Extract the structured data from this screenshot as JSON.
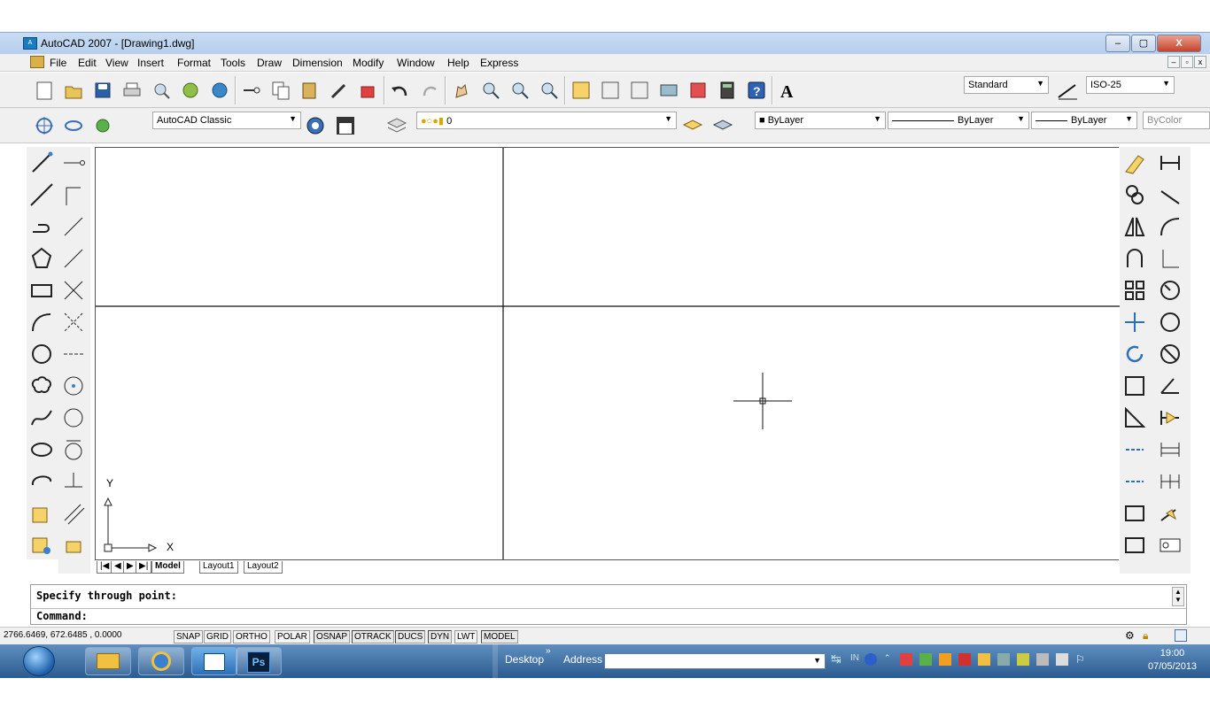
{
  "window": {
    "title": "AutoCAD 2007 - [Drawing1.dwg]",
    "controls": [
      "–",
      "▢",
      "X"
    ],
    "mdi_controls": [
      "–",
      "▫",
      "x"
    ]
  },
  "menu": [
    "File",
    "Edit",
    "View",
    "Insert",
    "Format",
    "Tools",
    "Draw",
    "Dimension",
    "Modify",
    "Window",
    "Help",
    "Express"
  ],
  "toolbar1": {
    "text_style": "Standard",
    "dim_style": "ISO-25"
  },
  "toolbar2": {
    "workspace": "AutoCAD Classic",
    "layer": "0",
    "color": "ByLayer",
    "linetype": "ByLayer",
    "lineweight": "ByLayer",
    "plotstyle": "ByColor"
  },
  "ucs": {
    "x_label": "X",
    "y_label": "Y"
  },
  "tabs": {
    "nav": [
      "|◀",
      "◀",
      "▶",
      "▶|"
    ],
    "items": [
      "Model",
      "Layout1",
      "Layout2"
    ]
  },
  "command": {
    "line1": "Specify through point:",
    "line2": "Command:"
  },
  "status": {
    "coords": "2766.6469, 672.6485 , 0.0000",
    "buttons": [
      "SNAP",
      "GRID",
      "ORTHO",
      "POLAR",
      "OSNAP",
      "OTRACK",
      "DUCS",
      "DYN",
      "LWT",
      "MODEL"
    ],
    "active": [
      "OSNAP",
      "OTRACK",
      "DUCS",
      "DYN",
      "MODEL"
    ]
  },
  "taskbar": {
    "desktop_label": "Desktop",
    "address_label": "Address",
    "lang": "IN",
    "time": "19:00",
    "date": "07/05/2013",
    "ps_label": "Ps"
  },
  "colors": {
    "titlebar": "#c9dcf2",
    "taskbar": "#2c5b8f",
    "close": "#c6432a"
  }
}
